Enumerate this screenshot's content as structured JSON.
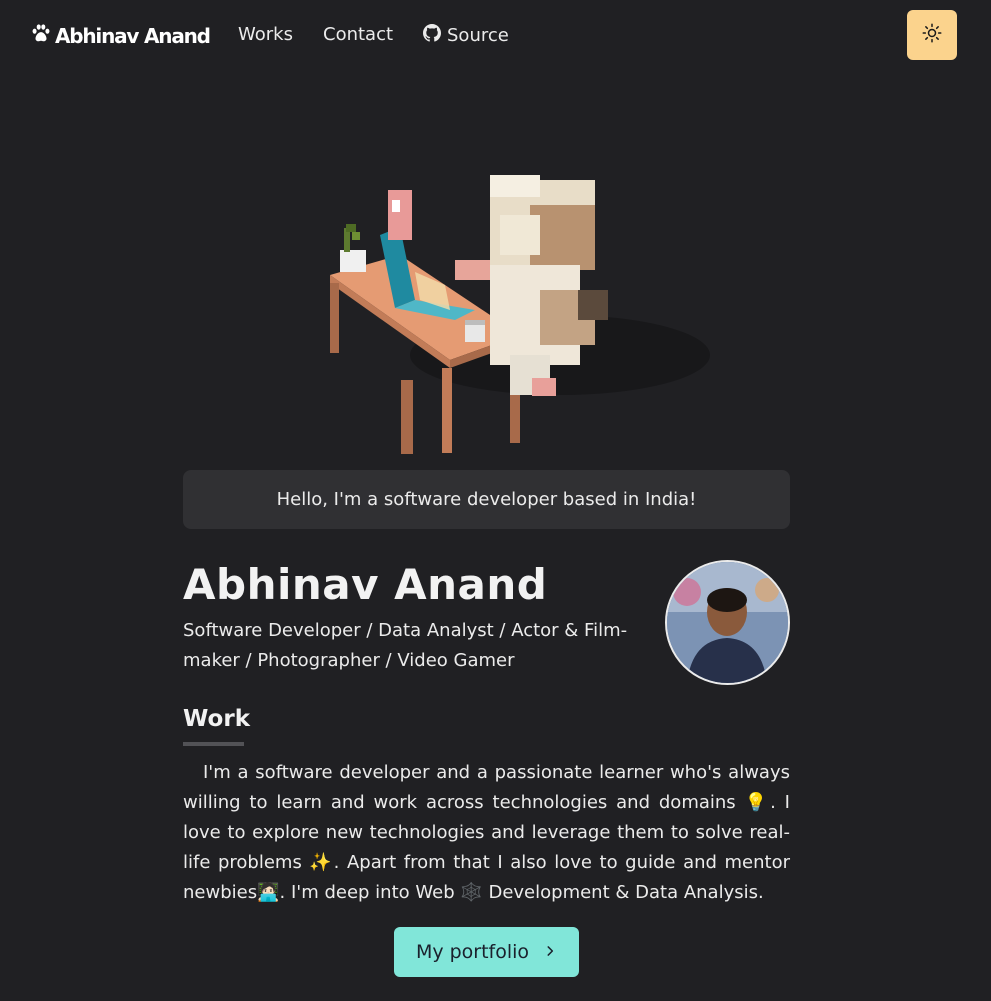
{
  "nav": {
    "logo_text": "Abhinav Anand",
    "logo_icon": "paw-icon",
    "links": [
      {
        "label": "Works"
      },
      {
        "label": "Contact"
      },
      {
        "label": "Source",
        "icon": "github-icon"
      }
    ],
    "theme_toggle_icon": "sun-icon",
    "theme_toggle_color": "#fbd38d"
  },
  "hero": {
    "greeting": "Hello, I'm a software developer based in India!"
  },
  "profile": {
    "name": "Abhinav Anand",
    "roles": "Software Developer / Data Analyst / Actor & Film-maker / Photographer / Video Gamer"
  },
  "work": {
    "heading": "Work",
    "paragraph": "I'm a software developer and a passionate learner who's always willing to learn and work across technologies and domains 💡. I love to explore new technologies and leverage them to solve real-life problems ✨. Apart from that I also love to guide and mentor newbies🧑🏻‍💻. I'm deep into Web 🕸️ Development & Data Analysis."
  },
  "cta": {
    "label": "My portfolio",
    "icon": "chevron-right-icon",
    "color": "#81e6d9"
  },
  "colors": {
    "background": "#202023",
    "card": "#303033"
  }
}
